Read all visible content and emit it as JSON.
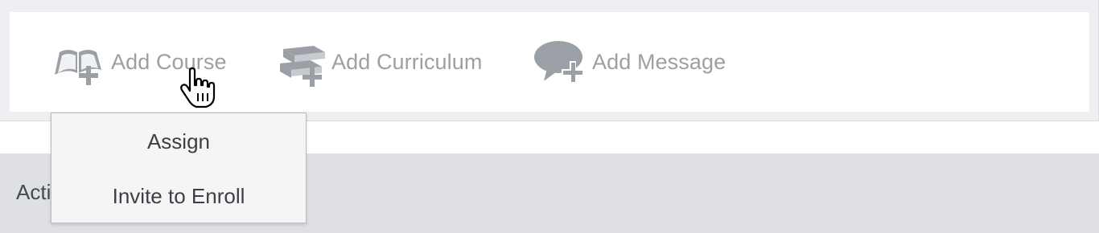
{
  "actions": {
    "add_course": {
      "label": "Add Course",
      "icon": "open-book-plus-icon"
    },
    "add_curriculum": {
      "label": "Add Curriculum",
      "icon": "book-stack-plus-icon"
    },
    "add_message": {
      "label": "Add Message",
      "icon": "speech-bubble-plus-icon"
    }
  },
  "dropdown": {
    "items": [
      {
        "label": "Assign"
      },
      {
        "label": "Invite to Enroll"
      }
    ]
  },
  "section_bar": {
    "label": "Acti"
  },
  "colors": {
    "icon_gray": "#9aa0a6",
    "panel_bg": "#eeeff3",
    "bar_bg": "#dfe0e3"
  }
}
